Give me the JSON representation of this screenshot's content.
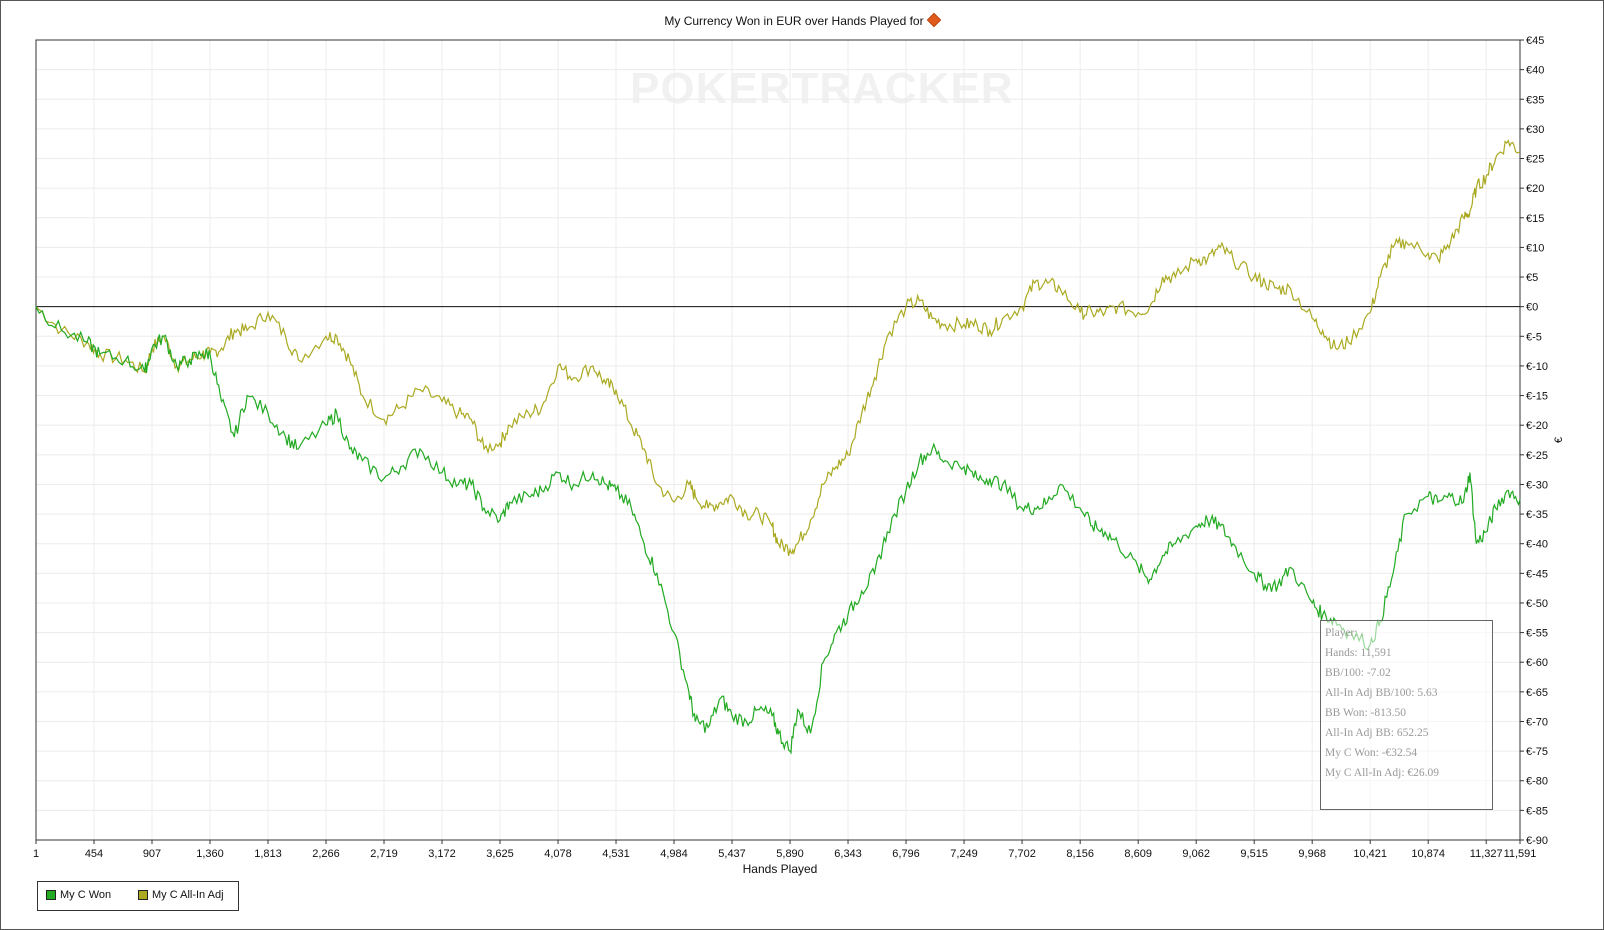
{
  "title": "My Currency Won in EUR over Hands Played for",
  "watermark": "POKERTRACKER",
  "chart_data": {
    "type": "line",
    "title": "My Currency Won in EUR over Hands Played for",
    "xlabel": "Hands Played",
    "ylabel": "€",
    "xlim": [
      1,
      11591
    ],
    "ylim": [
      -90,
      45
    ],
    "x_ticks": [
      "1",
      "454",
      "907",
      "1,360",
      "1,813",
      "2,266",
      "2,719",
      "3,172",
      "3,625",
      "4,078",
      "4,531",
      "4,984",
      "5,437",
      "5,890",
      "6,343",
      "6,796",
      "7,249",
      "7,702",
      "8,156",
      "8,609",
      "9,062",
      "9,515",
      "9,968",
      "10,421",
      "10,874",
      "11,327",
      "11,591"
    ],
    "y_ticks": [
      "€45",
      "€40",
      "€35",
      "€30",
      "€25",
      "€20",
      "€15",
      "€10",
      "€5",
      "€0",
      "€-5",
      "€-10",
      "€-15",
      "€-20",
      "€-25",
      "€-30",
      "€-35",
      "€-40",
      "€-45",
      "€-50",
      "€-55",
      "€-60",
      "€-65",
      "€-70",
      "€-75",
      "€-80",
      "€-85",
      "€-90"
    ],
    "grid": true,
    "zero_line": true,
    "legend_position": "bottom-left",
    "series": [
      {
        "name": "My C Won",
        "color": "#22aa22",
        "x": [
          1,
          200,
          400,
          500,
          700,
          850,
          907,
          1000,
          1100,
          1200,
          1300,
          1360,
          1450,
          1550,
          1650,
          1813,
          1950,
          2050,
          2266,
          2350,
          2450,
          2550,
          2719,
          2850,
          3000,
          3172,
          3300,
          3400,
          3500,
          3625,
          3700,
          3850,
          3950,
          4078,
          4200,
          4350,
          4450,
          4531,
          4650,
          4750,
          4850,
          4984,
          5100,
          5150,
          5250,
          5350,
          5437,
          5550,
          5650,
          5750,
          5800,
          5890,
          5950,
          6050,
          6150,
          6250,
          6343,
          6450,
          6550,
          6650,
          6796,
          6900,
          7000,
          7100,
          7249,
          7350,
          7450,
          7550,
          7702,
          7800,
          7900,
          8000,
          8156,
          8250,
          8350,
          8450,
          8609,
          8700,
          8800,
          8900,
          9062,
          9150,
          9250,
          9350,
          9515,
          9600,
          9700,
          9800,
          9968,
          10050,
          10150,
          10250,
          10421,
          10500,
          10600,
          10700,
          10874,
          10950,
          11050,
          11150,
          11200,
          11250,
          11327,
          11400,
          11500,
          11591
        ],
        "y": [
          0,
          -4,
          -6,
          -8,
          -9,
          -11,
          -7,
          -5,
          -10,
          -9,
          -8,
          -8,
          -16,
          -22,
          -15,
          -18,
          -22,
          -24,
          -20,
          -18,
          -24,
          -26,
          -29,
          -27,
          -24,
          -28,
          -30,
          -30,
          -34,
          -36,
          -33,
          -32,
          -31,
          -28,
          -30,
          -28,
          -30,
          -31,
          -34,
          -40,
          -45,
          -55,
          -65,
          -70,
          -71,
          -66,
          -69,
          -70,
          -68,
          -69,
          -72,
          -75,
          -68,
          -72,
          -60,
          -55,
          -52,
          -48,
          -45,
          -38,
          -31,
          -26,
          -24,
          -26,
          -27,
          -29,
          -29,
          -30,
          -34,
          -34,
          -33,
          -30,
          -34,
          -37,
          -38,
          -40,
          -44,
          -46,
          -42,
          -40,
          -37,
          -36,
          -37,
          -40,
          -45,
          -47,
          -47,
          -44,
          -50,
          -52,
          -53,
          -55,
          -57,
          -53,
          -45,
          -35,
          -32,
          -33,
          -32,
          -33,
          -28,
          -40,
          -38,
          -34,
          -31,
          -32.54
        ]
      },
      {
        "name": "My C All-In Adj",
        "color": "#aaaa22",
        "x": [
          1,
          200,
          400,
          500,
          700,
          850,
          907,
          1000,
          1100,
          1200,
          1300,
          1360,
          1450,
          1550,
          1650,
          1813,
          1950,
          2050,
          2266,
          2350,
          2450,
          2550,
          2719,
          2850,
          3000,
          3172,
          3300,
          3400,
          3500,
          3625,
          3700,
          3850,
          3950,
          4078,
          4200,
          4350,
          4450,
          4531,
          4650,
          4750,
          4850,
          4984,
          5100,
          5150,
          5250,
          5350,
          5437,
          5550,
          5650,
          5750,
          5800,
          5890,
          5950,
          6050,
          6150,
          6250,
          6343,
          6450,
          6550,
          6650,
          6796,
          6900,
          7000,
          7100,
          7249,
          7350,
          7450,
          7550,
          7702,
          7800,
          7900,
          8000,
          8156,
          8250,
          8350,
          8450,
          8609,
          8700,
          8800,
          8900,
          9062,
          9150,
          9250,
          9350,
          9515,
          9600,
          9700,
          9800,
          9968,
          10050,
          10150,
          10250,
          10421,
          10500,
          10600,
          10700,
          10874,
          10950,
          11050,
          11150,
          11200,
          11250,
          11327,
          11400,
          11500,
          11591
        ],
        "y": [
          0,
          -4,
          -6,
          -8,
          -9,
          -11,
          -7,
          -5,
          -10,
          -9,
          -8,
          -8,
          -7,
          -4,
          -4,
          -1,
          -5,
          -9,
          -5,
          -5,
          -9,
          -15,
          -19,
          -17,
          -14,
          -16,
          -18,
          -19,
          -24,
          -23,
          -20,
          -18,
          -17,
          -10,
          -12,
          -10,
          -13,
          -14,
          -20,
          -24,
          -30,
          -33,
          -30,
          -32,
          -34,
          -33,
          -32,
          -35,
          -35,
          -37,
          -40,
          -41,
          -40,
          -36,
          -30,
          -27,
          -25,
          -18,
          -12,
          -5,
          0,
          1,
          -2,
          -3,
          -3,
          -3,
          -4,
          -2,
          0,
          4,
          4,
          3,
          -1,
          -1,
          -1,
          0,
          -1,
          0,
          5,
          5,
          8,
          8,
          10,
          8,
          5,
          4,
          3,
          3,
          -2,
          -4,
          -7,
          -6,
          -1,
          5,
          10,
          11,
          9,
          8,
          11,
          15,
          16,
          20,
          22,
          25,
          28,
          26.09
        ]
      }
    ]
  },
  "legend": {
    "items": [
      {
        "label": "My C Won",
        "color": "#22aa22"
      },
      {
        "label": "My C All-In Adj",
        "color": "#aaaa22"
      }
    ]
  },
  "tooltip": {
    "lines": [
      "Player: .",
      "Hands: 11,591",
      "BB/100: -7.02",
      "All-In Adj BB/100: 5.63",
      "BB Won: -813.50",
      "All-In Adj BB: 652.25",
      "My C Won: -€32.54",
      "My C All-In Adj: €26.09"
    ]
  }
}
